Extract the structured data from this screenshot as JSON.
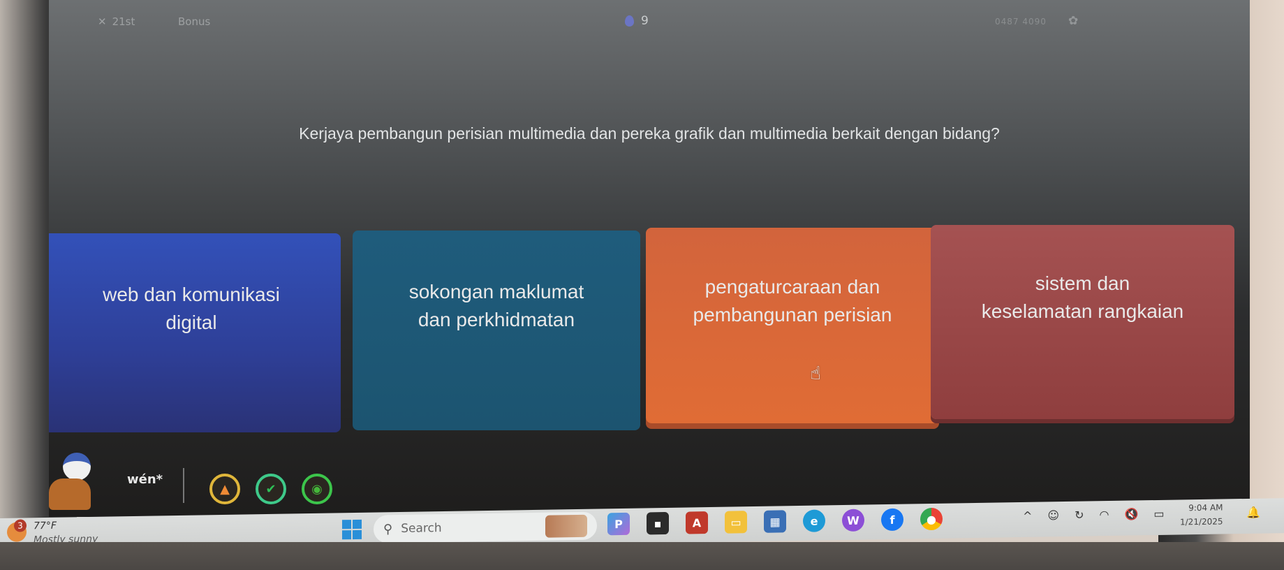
{
  "game": {
    "topbar": {
      "streak_label": "21st",
      "bonus_label": "Bonus",
      "gem_count": "9",
      "session_code": "0487 4090"
    },
    "question": "Kerjaya pembangun perisian multimedia dan pereka grafik dan multimedia berkait dengan bidang?",
    "answers": [
      {
        "line1": "web dan komunikasi",
        "line2": "digital",
        "color": "#3351b9"
      },
      {
        "line1": "sokongan maklumat",
        "line2": "dan perkhidmatan",
        "color": "#1f5c7c"
      },
      {
        "line1": "pengaturcaraan dan",
        "line2": "pembangunan perisian",
        "color": "#e06c35"
      },
      {
        "line1": "sistem dan",
        "line2": "keselamatan rangkaian",
        "color": "#9c4848"
      }
    ],
    "player": {
      "name": "wén*",
      "powerups": [
        "rocket-powerup",
        "shield-powerup",
        "mask-powerup"
      ]
    }
  },
  "taskbar": {
    "weather": {
      "badge": "3",
      "temperature": "77°F",
      "condition": "Mostly sunny"
    },
    "search_placeholder": "Search",
    "pinned_apps": [
      "copilot-pre",
      "terminal",
      "acrobat",
      "file-explorer",
      "microsoft-store",
      "edge",
      "wps-office",
      "facebook",
      "chrome"
    ],
    "tray": {
      "time": "9:04 AM",
      "date": "1/21/2025"
    }
  }
}
